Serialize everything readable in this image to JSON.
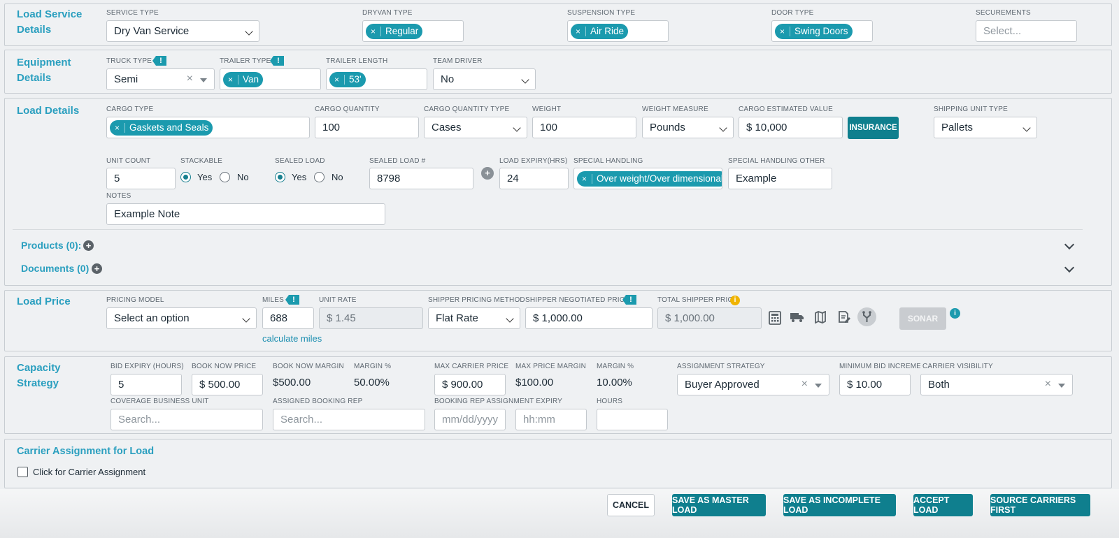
{
  "colors": {
    "accent": "#1b9aae",
    "button": "#0f7f8e",
    "title": "#2a9fbf"
  },
  "service": {
    "title_line1": "Load Service",
    "title_line2": "Details",
    "service_type": {
      "label": "SERVICE TYPE",
      "value": "Dry Van Service"
    },
    "dryvan_type": {
      "label": "DRYVAN TYPE",
      "chip": "Regular"
    },
    "suspension_type": {
      "label": "SUSPENSION TYPE",
      "chip": "Air Ride"
    },
    "door_type": {
      "label": "DOOR TYPE",
      "chip": "Swing Doors"
    },
    "securements": {
      "label": "SECUREMENTS",
      "placeholder": "Select..."
    }
  },
  "equipment": {
    "title_line1": "Equipment",
    "title_line2": "Details",
    "truck_type": {
      "label": "TRUCK TYPE",
      "value": "Semi"
    },
    "trailer_type": {
      "label": "TRAILER TYPE",
      "chip": "Van"
    },
    "trailer_length": {
      "label": "TRAILER LENGTH",
      "chip": "53'"
    },
    "team_driver": {
      "label": "TEAM DRIVER",
      "value": "No"
    },
    "flag": "!"
  },
  "load": {
    "title": "Load Details",
    "cargo_type": {
      "label": "CARGO TYPE",
      "chip": "Gaskets and Seals"
    },
    "cargo_quantity": {
      "label": "CARGO QUANTITY",
      "value": "100"
    },
    "cargo_quantity_type": {
      "label": "CARGO QUANTITY TYPE",
      "value": "Cases"
    },
    "weight": {
      "label": "WEIGHT",
      "value": "100"
    },
    "weight_measure": {
      "label": "WEIGHT MEASURE",
      "value": "Pounds"
    },
    "cargo_value": {
      "label": "CARGO ESTIMATED VALUE",
      "value": "$ 10,000"
    },
    "insurance_button": "INSURANCE",
    "shipping_unit_type": {
      "label": "SHIPPING UNIT TYPE",
      "value": "Pallets"
    },
    "unit_count": {
      "label": "UNIT COUNT",
      "value": "5"
    },
    "stackable": {
      "label": "STACKABLE",
      "yes": "Yes",
      "no": "No",
      "selected": "Yes"
    },
    "sealed_load": {
      "label": "SEALED LOAD",
      "yes": "Yes",
      "no": "No",
      "selected": "Yes"
    },
    "sealed_load_no": {
      "label": "SEALED LOAD #",
      "value": "8798"
    },
    "load_expiry": {
      "label": "LOAD EXPIRY(HRS)",
      "value": "24"
    },
    "special_handling": {
      "label": "SPECIAL HANDLING",
      "chip": "Over weight/Over dimensional"
    },
    "special_handling_other": {
      "label": "SPECIAL HANDLING OTHER",
      "value": "Example"
    },
    "notes": {
      "label": "NOTES",
      "value": "Example Note"
    },
    "products": "Products (0):",
    "documents": "Documents (0)"
  },
  "price": {
    "title": "Load Price",
    "pricing_model": {
      "label": "PRICING MODEL",
      "value": "Select an option"
    },
    "miles": {
      "label": "MILES",
      "value": "688"
    },
    "calculate_miles": "calculate miles",
    "unit_rate": {
      "label": "UNIT RATE",
      "value": "$ 1.45"
    },
    "shipper_pricing_method": {
      "label": "SHIPPER PRICING METHOD",
      "value": "Flat Rate"
    },
    "shipper_negotiated_price": {
      "label": "SHIPPER NEGOTIATED PRICE",
      "value": "$ 1,000.00"
    },
    "total_shipper_price": {
      "label": "TOTAL SHIPPER PRICE",
      "value": "$ 1,000.00"
    },
    "sonar_button": "SONAR",
    "icons": [
      "calculator-icon",
      "truck-icon",
      "map-icon",
      "edit-doc-icon",
      "fork-icon",
      "info-icon"
    ]
  },
  "capacity": {
    "title_line1": "Capacity",
    "title_line2": "Strategy",
    "bid_expiry": {
      "label": "BID EXPIRY (HOURS)",
      "value": "5"
    },
    "book_now_price": {
      "label": "BOOK NOW PRICE",
      "value": "$ 500.00"
    },
    "book_now_margin": {
      "label": "BOOK NOW MARGIN",
      "value": "$500.00"
    },
    "margin_pct_1": {
      "label": "MARGIN %",
      "value": "50.00%"
    },
    "max_carrier_price": {
      "label": "MAX CARRIER PRICE",
      "value": "$ 900.00"
    },
    "max_price_margin": {
      "label": "MAX PRICE MARGIN",
      "value": "$100.00"
    },
    "margin_pct_2": {
      "label": "MARGIN %",
      "value": "10.00%"
    },
    "assignment_strategy": {
      "label": "ASSIGNMENT STRATEGY",
      "value": "Buyer Approved"
    },
    "minimum_bid_increment": {
      "label": "MINIMUM BID INCREMENT",
      "value": "$ 10.00"
    },
    "carrier_visibility": {
      "label": "CARRIER VISIBILITY",
      "value": "Both"
    },
    "coverage_business_unit": {
      "label": "COVERAGE BUSINESS UNIT",
      "placeholder": "Search..."
    },
    "assigned_booking_rep": {
      "label": "ASSIGNED BOOKING REP",
      "placeholder": "Search..."
    },
    "booking_rep_expiry": {
      "label": "BOOKING REP ASSIGNMENT EXPIRY",
      "date_placeholder": "mm/dd/yyyy",
      "time_placeholder": "hh:mm"
    },
    "hours": {
      "label": "HOURS",
      "value": ""
    }
  },
  "carrier": {
    "title": "Carrier Assignment for Load",
    "checkbox_label": "Click for Carrier Assignment"
  },
  "footer": {
    "cancel": "CANCEL",
    "save_master": "SAVE AS MASTER LOAD",
    "save_incomplete": "SAVE AS INCOMPLETE LOAD",
    "accept": "ACCEPT LOAD",
    "source_carriers": "SOURCE CARRIERS FIRST"
  }
}
